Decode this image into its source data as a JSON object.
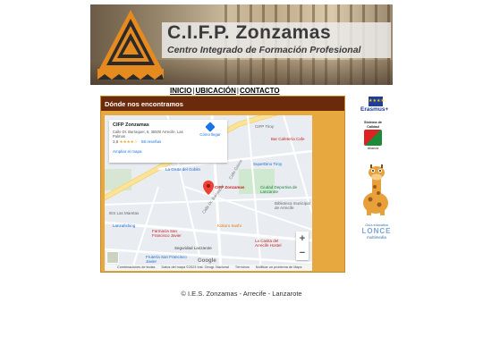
{
  "banner": {
    "title": "C.I.F.P. Zonzamas",
    "subtitle": "Centro Integrado de Formación Profesional"
  },
  "nav": {
    "items": [
      {
        "label": "INICIO"
      },
      {
        "label": "UBICACIÓN"
      },
      {
        "label": "CONTACTO"
      }
    ],
    "separator": "|"
  },
  "section": {
    "heading": "Dónde nos encontramos"
  },
  "map": {
    "place_name": "CIFP Zonzamas",
    "address": "Calle Dr. Barraquer, 6, 35500 Arrecife, Las Palmas",
    "rating": "3,8",
    "stars": "★★★★☆",
    "reviews": "58 reseñas",
    "bigger_map": "Ampliar el mapa",
    "directions": "Cómo llegar",
    "labels": {
      "tiroy": "CIFP Tiroy",
      "cafe": "Bar Cafetería Cafe",
      "gruta": "La Gruta del Goblin",
      "superdino": "SuperDino Tiroy",
      "marker": "CIFP Zonzamas",
      "ciudad": "Ciudad Deportiva de Lanzarote",
      "biblioteca": "Biblioteca municipal de Arrecife",
      "maretas": "IES Las Maretas",
      "lanzafishing": "Lanzafishing",
      "farmacia": "Farmacia San Francisco Javier",
      "kokoro": "Kokoro Sushi",
      "seguridad": "Seguridad Lanzarote",
      "casa": "La Casita del Arrecife Hostel",
      "fruteria": "Frutería San Francisco Javier",
      "google": "Google",
      "calle1": "Calle Dr. Barraquer",
      "calle2": "Calle Gasca"
    },
    "zoom_in": "+",
    "zoom_out": "−",
    "footer": [
      "Combinaciones de teclas",
      "Datos del mapa ©2023 Inst. Geogr. Nacional",
      "Términos",
      "Notificar un problema de Maps"
    ]
  },
  "sidebar": {
    "eu_stars": "★★★★",
    "erasmus": "Erasmus+",
    "quality_top": "Sistema de Calidad",
    "quality_bottom": "Alianza",
    "guia_top": "Guía educativa",
    "guia_main": "LONCE",
    "guia_bottom": "multimedia"
  },
  "footer": {
    "copyright": "© I.E.S. Zonzamas - Arrecife - Lanzarote"
  },
  "colors": {
    "header_bg": "#6b2a0a",
    "box_bg": "#e8a840",
    "link": "#1a73e8"
  }
}
